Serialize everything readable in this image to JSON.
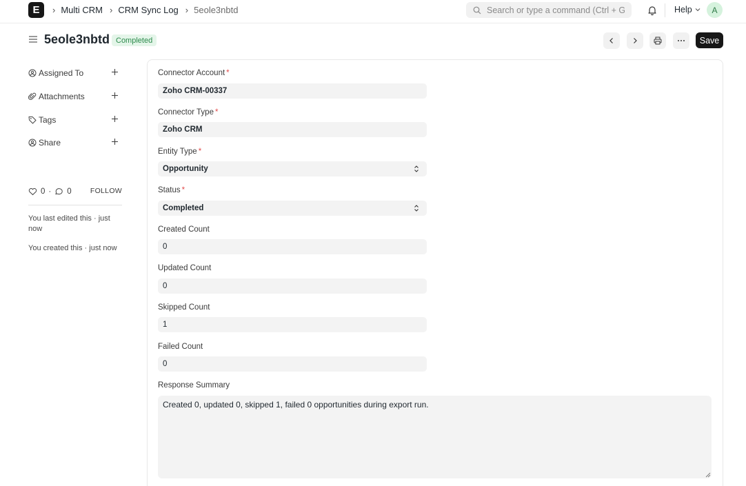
{
  "navbar": {
    "logo_letter": "E",
    "breadcrumbs": [
      "Multi CRM",
      "CRM Sync Log",
      "5eole3nbtd"
    ],
    "search_placeholder": "Search or type a command (Ctrl + G)",
    "help_label": "Help",
    "avatar_initial": "A"
  },
  "page": {
    "title": "5eole3nbtd",
    "status": "Completed",
    "save_label": "Save"
  },
  "sidebar": {
    "items": [
      {
        "label": "Assigned To",
        "icon": "user-add-icon"
      },
      {
        "label": "Attachments",
        "icon": "paperclip-icon"
      },
      {
        "label": "Tags",
        "icon": "tag-icon"
      },
      {
        "label": "Share",
        "icon": "share-user-icon"
      }
    ],
    "likes": "0",
    "comments": "0",
    "follow_label": "FOLLOW",
    "activity": [
      "You last edited this · just now",
      "You created this · just now"
    ]
  },
  "form": {
    "connector_account": {
      "label": "Connector Account",
      "value": "Zoho CRM-00337"
    },
    "connector_type": {
      "label": "Connector Type",
      "value": "Zoho CRM"
    },
    "entity_type": {
      "label": "Entity Type",
      "value": "Opportunity"
    },
    "status": {
      "label": "Status",
      "value": "Completed"
    },
    "created_count": {
      "label": "Created Count",
      "value": "0"
    },
    "updated_count": {
      "label": "Updated Count",
      "value": "0"
    },
    "skipped_count": {
      "label": "Skipped Count",
      "value": "1"
    },
    "failed_count": {
      "label": "Failed Count",
      "value": "0"
    },
    "response_summary": {
      "label": "Response Summary",
      "value": "Created 0, updated 0, skipped 1, failed 0 opportunities during export run."
    }
  },
  "colors": {
    "accent_dark": "#171717",
    "status_green_bg": "#e4f5e9",
    "status_green_text": "#2b8a4b",
    "required_red": "#e24c4c"
  }
}
